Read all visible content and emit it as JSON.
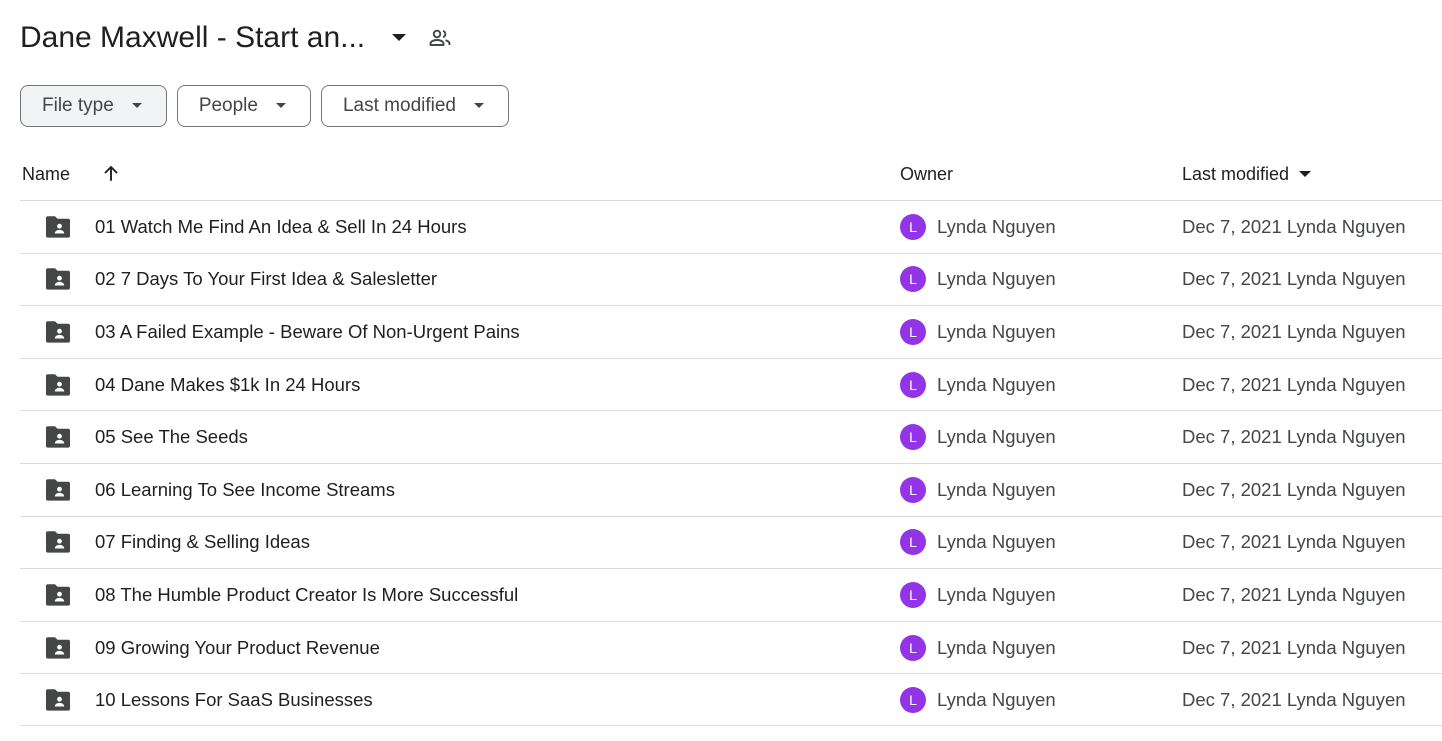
{
  "header": {
    "title": "Dane Maxwell - Start an...",
    "title_dropdown_icon": "caret-down-icon",
    "shared_icon": "people-icon"
  },
  "filters": [
    {
      "label": "File type",
      "icon": "caret-down-icon",
      "active": true
    },
    {
      "label": "People",
      "icon": "caret-down-icon",
      "active": false
    },
    {
      "label": "Last modified",
      "icon": "caret-down-icon",
      "active": false
    }
  ],
  "columns": {
    "name": "Name",
    "name_sort_icon": "arrow-up-icon",
    "owner": "Owner",
    "last_modified": "Last modified",
    "last_modified_icon": "caret-down-icon"
  },
  "rows": [
    {
      "name": "01 Watch Me Find An Idea & Sell In 24 Hours",
      "owner_initial": "L",
      "owner": "Lynda Nguyen",
      "modified": "Dec 7, 2021 Lynda Nguyen"
    },
    {
      "name": "02 7 Days To Your First Idea & Salesletter",
      "owner_initial": "L",
      "owner": "Lynda Nguyen",
      "modified": "Dec 7, 2021 Lynda Nguyen"
    },
    {
      "name": "03 A Failed Example - Beware Of Non-Urgent Pains",
      "owner_initial": "L",
      "owner": "Lynda Nguyen",
      "modified": "Dec 7, 2021 Lynda Nguyen"
    },
    {
      "name": "04 Dane Makes $1k In 24 Hours",
      "owner_initial": "L",
      "owner": "Lynda Nguyen",
      "modified": "Dec 7, 2021 Lynda Nguyen"
    },
    {
      "name": "05 See The Seeds",
      "owner_initial": "L",
      "owner": "Lynda Nguyen",
      "modified": "Dec 7, 2021 Lynda Nguyen"
    },
    {
      "name": "06 Learning To See Income Streams",
      "owner_initial": "L",
      "owner": "Lynda Nguyen",
      "modified": "Dec 7, 2021 Lynda Nguyen"
    },
    {
      "name": "07 Finding & Selling Ideas",
      "owner_initial": "L",
      "owner": "Lynda Nguyen",
      "modified": "Dec 7, 2021 Lynda Nguyen"
    },
    {
      "name": "08 The Humble Product Creator Is More Successful",
      "owner_initial": "L",
      "owner": "Lynda Nguyen",
      "modified": "Dec 7, 2021 Lynda Nguyen"
    },
    {
      "name": "09 Growing Your Product Revenue",
      "owner_initial": "L",
      "owner": "Lynda Nguyen",
      "modified": "Dec 7, 2021 Lynda Nguyen"
    },
    {
      "name": "10 Lessons For SaaS Businesses",
      "owner_initial": "L",
      "owner": "Lynda Nguyen",
      "modified": "Dec 7, 2021 Lynda Nguyen"
    }
  ],
  "colors": {
    "avatar": "#9334e6",
    "text_primary": "#1f1f1f",
    "text_secondary": "#444746",
    "divider": "#dadce0",
    "icon": "#444746"
  }
}
